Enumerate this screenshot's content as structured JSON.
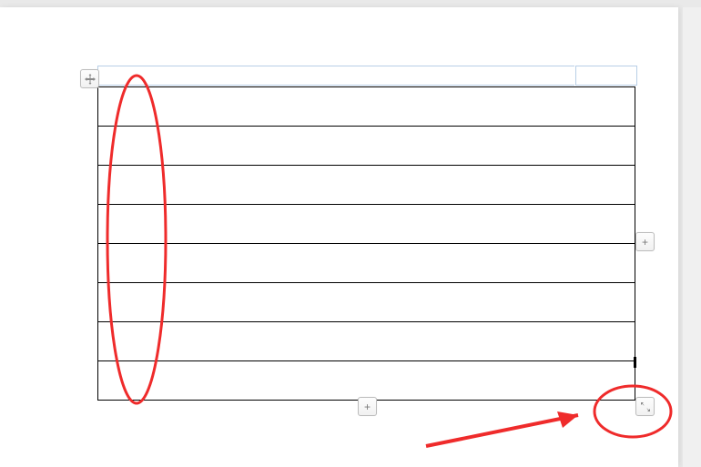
{
  "table": {
    "rows": 8,
    "cols": 1
  },
  "controls": {
    "move_tooltip": "Move table",
    "add_column_label": "+",
    "add_row_label": "+",
    "resize_tooltip": "Resize table"
  },
  "annotations": {
    "ellipse_note": "First column highlighted",
    "arrow_note": "Resize handle indicated"
  }
}
